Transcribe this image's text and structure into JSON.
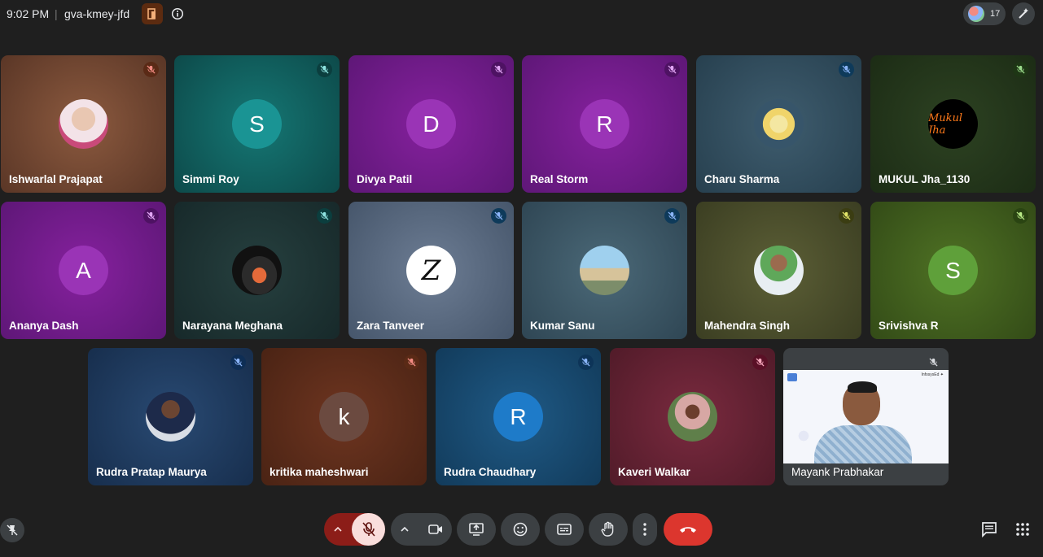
{
  "header": {
    "time": "9:02 PM",
    "separator": "|",
    "meeting_code": "gva-kmey-jfd",
    "participant_count": "17"
  },
  "participants": [
    {
      "name": "Ishwarlal Prajapat",
      "avatar_type": "photo",
      "initial": ""
    },
    {
      "name": "Simmi Roy",
      "avatar_type": "initial",
      "initial": "S"
    },
    {
      "name": "Divya Patil",
      "avatar_type": "initial",
      "initial": "D"
    },
    {
      "name": "Real Storm",
      "avatar_type": "initial",
      "initial": "R"
    },
    {
      "name": "Charu Sharma",
      "avatar_type": "photo",
      "initial": ""
    },
    {
      "name": "MUKUL Jha_1130",
      "avatar_type": "logo",
      "initial": "",
      "logo_text": "Mukul Jha"
    },
    {
      "name": "Ananya Dash",
      "avatar_type": "initial",
      "initial": "A"
    },
    {
      "name": "Narayana Meghana",
      "avatar_type": "photo",
      "initial": ""
    },
    {
      "name": "Zara Tanveer",
      "avatar_type": "logo",
      "initial": "",
      "logo_text": "Z"
    },
    {
      "name": "Kumar Sanu",
      "avatar_type": "photo",
      "initial": ""
    },
    {
      "name": "Mahendra Singh",
      "avatar_type": "photo",
      "initial": ""
    },
    {
      "name": "Srivishva R",
      "avatar_type": "initial",
      "initial": "S"
    },
    {
      "name": "Rudra Pratap Maurya",
      "avatar_type": "photo",
      "initial": ""
    },
    {
      "name": "kritika maheshwari",
      "avatar_type": "initial",
      "initial": "k"
    },
    {
      "name": "Rudra Chaudhary",
      "avatar_type": "initial",
      "initial": "R"
    },
    {
      "name": "Kaveri Walkar",
      "avatar_type": "photo",
      "initial": ""
    },
    {
      "name": "Mayank Prabhakar",
      "avatar_type": "video",
      "initial": ""
    }
  ],
  "video_overlay_text": "InfosysEd ✦",
  "colors": {
    "background": "#1f1f1f",
    "end_call": "#dc362e",
    "mic_off": "#8c1d18",
    "control_bg": "#3c4043"
  },
  "controls": [
    "mic-options-icon",
    "mic-off-icon",
    "camera-options-icon",
    "camera-icon",
    "present-icon",
    "emoji-icon",
    "captions-icon",
    "raise-hand-icon",
    "more-options-icon",
    "end-call-icon",
    "chat-icon",
    "activities-icon"
  ]
}
